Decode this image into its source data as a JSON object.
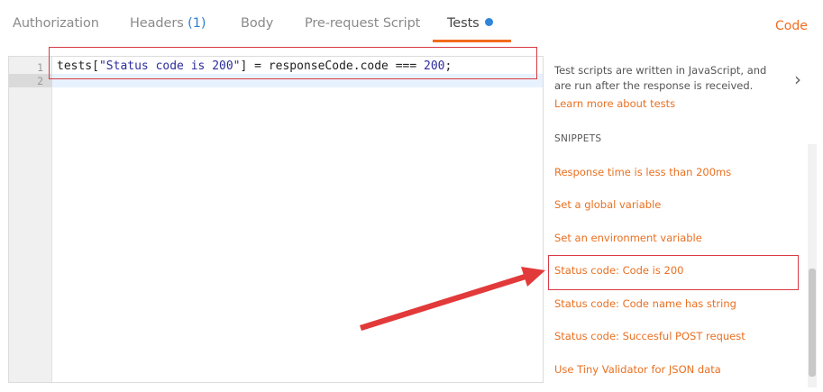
{
  "tabs": {
    "authorization": "Authorization",
    "headers_label": "Headers",
    "headers_count": "(1)",
    "body": "Body",
    "prerequest": "Pre-request Script",
    "tests": "Tests",
    "code": "Code"
  },
  "editor": {
    "line_numbers": [
      "1",
      "2"
    ],
    "code": {
      "part1": "tests[",
      "str": "\"Status code is 200\"",
      "part2": "] = responseCode.code === ",
      "num": "200",
      "part3": ";"
    }
  },
  "sidebar": {
    "description": "Test scripts are written in JavaScript, and are run after the response is received.",
    "learn_more": "Learn more about tests",
    "snippets_heading": "SNIPPETS",
    "snippets": [
      "Response time is less than 200ms",
      "Set a global variable",
      "Set an environment variable",
      "Status code: Code is 200",
      "Status code: Code name has string",
      "Status code: Succesful POST request",
      "Use Tiny Validator for JSON data"
    ]
  },
  "colors": {
    "accent": "#f26b1d",
    "annotation_red": "#d93a45",
    "tab_dot": "#2f85d8"
  },
  "icons": [
    "chevron-right-icon",
    "unsaved-dot-icon"
  ]
}
